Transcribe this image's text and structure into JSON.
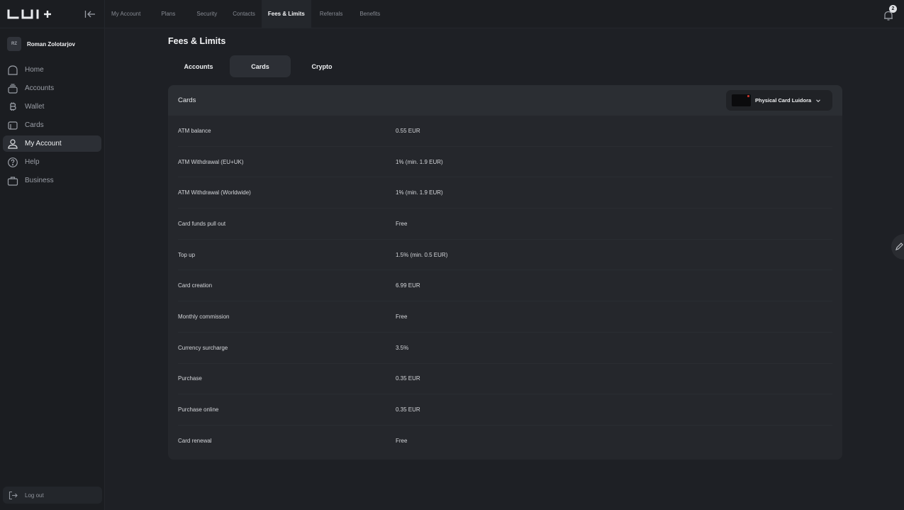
{
  "app": {
    "logo_text": "LUI+"
  },
  "user": {
    "initials": "RZ",
    "name": "Roman Zolotarjov"
  },
  "sidebar": {
    "items": [
      {
        "label": "Home",
        "icon": "home-icon"
      },
      {
        "label": "Accounts",
        "icon": "accounts-icon"
      },
      {
        "label": "Wallet",
        "icon": "bitcoin-icon"
      },
      {
        "label": "Cards",
        "icon": "cards-icon"
      },
      {
        "label": "My Account",
        "icon": "user-icon",
        "active": true
      },
      {
        "label": "Help",
        "icon": "help-icon"
      },
      {
        "label": "Business",
        "icon": "briefcase-icon"
      }
    ],
    "logout_label": "Log out"
  },
  "topnav": {
    "tabs": [
      {
        "label": "My Account"
      },
      {
        "label": "Plans"
      },
      {
        "label": "Security"
      },
      {
        "label": "Contacts"
      },
      {
        "label": "Fees & Limits",
        "active": true
      },
      {
        "label": "Referrals"
      },
      {
        "label": "Benefits"
      }
    ],
    "notification_count": "2"
  },
  "page": {
    "title": "Fees & Limits",
    "subtabs": [
      {
        "label": "Accounts"
      },
      {
        "label": "Cards",
        "active": true
      },
      {
        "label": "Crypto"
      }
    ]
  },
  "fees_card": {
    "title": "Cards",
    "card_selector": "Physical Card Luidora",
    "rows": [
      {
        "label": "ATM balance",
        "value": "0.55 EUR"
      },
      {
        "label": "ATM Withdrawal (EU+UK)",
        "value": "1% (min. 1.9 EUR)"
      },
      {
        "label": "ATM Withdrawal (Worldwide)",
        "value": "1% (min. 1.9 EUR)"
      },
      {
        "label": "Card funds pull out",
        "value": "Free"
      },
      {
        "label": "Top up",
        "value": "1.5% (min. 0.5 EUR)"
      },
      {
        "label": "Card creation",
        "value": "6.99 EUR"
      },
      {
        "label": "Monthly commission",
        "value": "Free"
      },
      {
        "label": "Currency surcharge",
        "value": "3.5%"
      },
      {
        "label": "Purchase",
        "value": "0.35 EUR"
      },
      {
        "label": "Purchase online",
        "value": "0.35 EUR"
      },
      {
        "label": "Card renewal",
        "value": "Free"
      }
    ]
  },
  "colors": {
    "background": "#1e2025",
    "sidebar": "#1b1d21",
    "panel": "#25272c",
    "active": "#2c2f35",
    "text": "#d6d8dc"
  }
}
